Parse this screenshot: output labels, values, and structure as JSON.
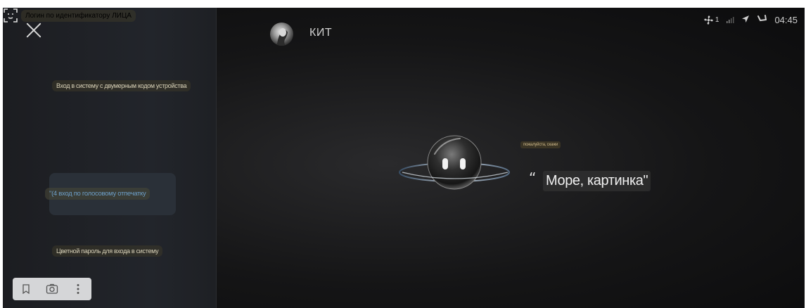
{
  "assistant": {
    "name": "КИТ"
  },
  "status_bar": {
    "time": "04:45",
    "fan_level": "1"
  },
  "menu": {
    "login_2d_code": "Вход в систему с двумерным кодом устройства",
    "face_login": "Логин по идентификатору ЛИЦА",
    "voice_login": "\"(4 вход по голосовому отпечатку",
    "color_password": "Цветной пароль для входа в систему"
  },
  "conversation": {
    "hint": "пожалуйста, скажи",
    "open_quote": "“",
    "phrase": "Море, картинка\""
  },
  "icons": {
    "close": "close-icon",
    "face_id": "face-id-icon",
    "bookmark": "bookmark-icon",
    "camera": "camera-icon",
    "more": "more-vert-icon",
    "fan": "fan-icon",
    "signal": "signal-icon",
    "location": "location-arrow-icon",
    "seat_heat": "seat-icon"
  },
  "colors": {
    "accent_voice": "#6d9fc9",
    "label_text": "#d8d1b8",
    "background": "#151516"
  }
}
